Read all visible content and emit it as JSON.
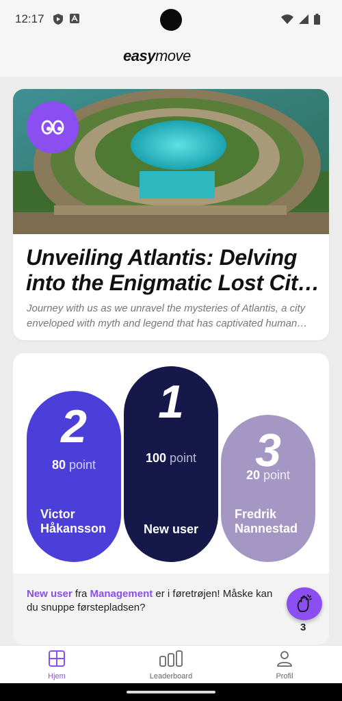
{
  "status_bar": {
    "time": "12:17"
  },
  "header": {
    "logo_bold": "easy",
    "logo_light": "move"
  },
  "article": {
    "title": "Unveiling Atlantis: Delving into the Enigmatic Lost City of Atlantis",
    "description": "Journey with us as we unravel the mysteries of Atlantis, a city enveloped with myth and legend that has captivated human imagination for centuries.",
    "badge_icon": "eyes-icon"
  },
  "leaderboard": {
    "entries": [
      {
        "rank": "2",
        "points": "80",
        "unit": "point",
        "name": "Victor Håkansson"
      },
      {
        "rank": "1",
        "points": "100",
        "unit": "point",
        "name": "New user"
      },
      {
        "rank": "3",
        "points": "20",
        "unit": "point",
        "name": "Fredrik Nannestad"
      }
    ],
    "banner": {
      "user": "New user",
      "from_word": " fra ",
      "team": "Management",
      "message": " er i føretrøjen! Måske kan du snuppe førstepladsen?",
      "wave_count": "3"
    }
  },
  "nav": {
    "home": "Hjem",
    "leaderboard": "Leaderboard",
    "profile": "Profil"
  },
  "colors": {
    "accent": "#8b4ef0",
    "second_place": "#4c3ed8",
    "first_place": "#17184a",
    "third_place": "#a497c4"
  }
}
